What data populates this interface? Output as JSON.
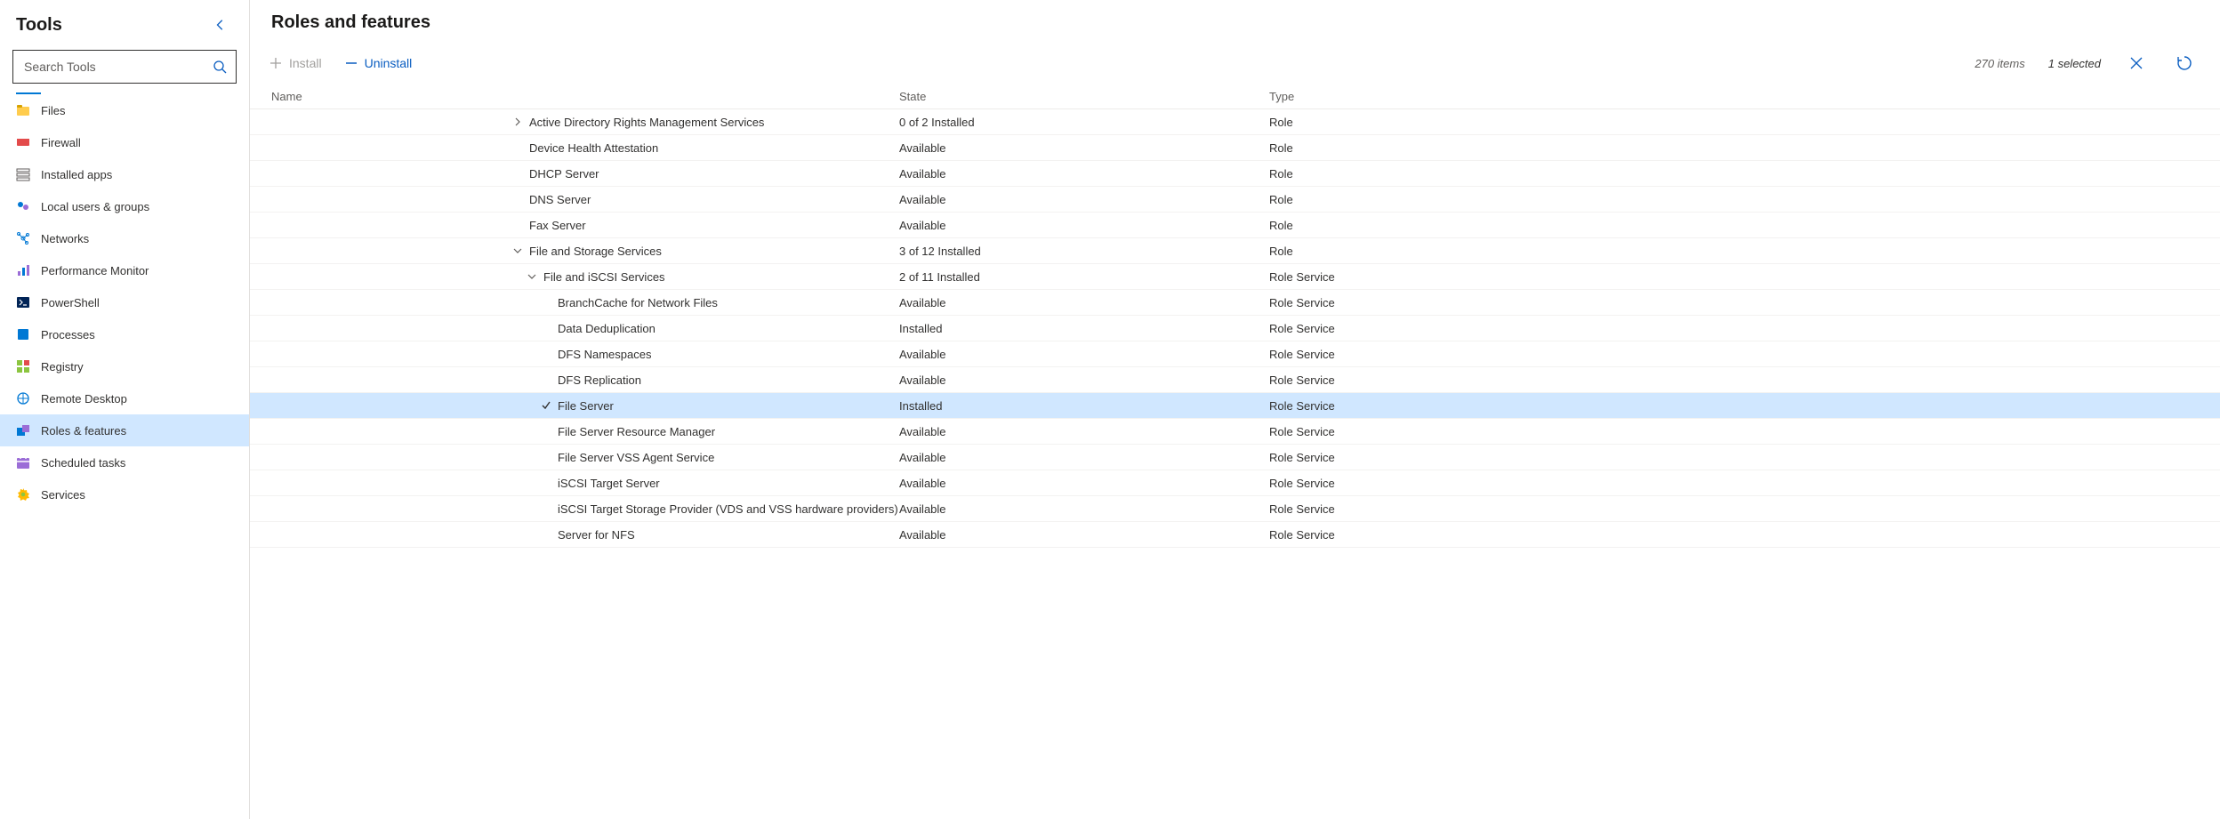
{
  "sidebar": {
    "title": "Tools",
    "search_placeholder": "Search Tools",
    "items": [
      {
        "label": "Files",
        "icon": "files-icon",
        "iconClass": "ic-files"
      },
      {
        "label": "Firewall",
        "icon": "firewall-icon",
        "iconClass": "ic-fire"
      },
      {
        "label": "Installed apps",
        "icon": "apps-icon",
        "iconClass": "ic-apps"
      },
      {
        "label": "Local users & groups",
        "icon": "users-groups-icon",
        "iconClass": "ic-usersg"
      },
      {
        "label": "Networks",
        "icon": "networks-icon",
        "iconClass": "ic-net"
      },
      {
        "label": "Performance Monitor",
        "icon": "perfmon-icon",
        "iconClass": "ic-perf"
      },
      {
        "label": "PowerShell",
        "icon": "powershell-icon",
        "iconClass": "ic-ps"
      },
      {
        "label": "Processes",
        "icon": "processes-icon",
        "iconClass": "ic-proc"
      },
      {
        "label": "Registry",
        "icon": "registry-icon",
        "iconClass": "ic-reg"
      },
      {
        "label": "Remote Desktop",
        "icon": "remote-desktop-icon",
        "iconClass": "ic-rdp"
      },
      {
        "label": "Roles & features",
        "icon": "roles-features-icon",
        "iconClass": "ic-roles",
        "selected": true
      },
      {
        "label": "Scheduled tasks",
        "icon": "scheduled-tasks-icon",
        "iconClass": "ic-sched"
      },
      {
        "label": "Services",
        "icon": "services-icon",
        "iconClass": "ic-svc"
      }
    ]
  },
  "page": {
    "title": "Roles and features",
    "install_label": "Install",
    "uninstall_label": "Uninstall",
    "items_count_label": "270 items",
    "selected_label": "1 selected"
  },
  "grid": {
    "headers": {
      "name": "Name",
      "state": "State",
      "type": "Type"
    },
    "baseIndent": 310,
    "rows": [
      {
        "indent": 0,
        "chevron": "right",
        "checked": false,
        "name": "Active Directory Rights Management Services",
        "state": "0 of 2 Installed",
        "type": "Role"
      },
      {
        "indent": 0,
        "chevron": "none",
        "checked": false,
        "name": "Device Health Attestation",
        "state": "Available",
        "type": "Role"
      },
      {
        "indent": 0,
        "chevron": "none",
        "checked": false,
        "name": "DHCP Server",
        "state": "Available",
        "type": "Role"
      },
      {
        "indent": 0,
        "chevron": "none",
        "checked": false,
        "name": "DNS Server",
        "state": "Available",
        "type": "Role"
      },
      {
        "indent": 0,
        "chevron": "none",
        "checked": false,
        "name": "Fax Server",
        "state": "Available",
        "type": "Role"
      },
      {
        "indent": 0,
        "chevron": "down",
        "checked": false,
        "name": "File and Storage Services",
        "state": "3 of 12 Installed",
        "type": "Role"
      },
      {
        "indent": 1,
        "chevron": "down",
        "checked": false,
        "name": "File and iSCSI Services",
        "state": "2 of 11 Installed",
        "type": "Role Service"
      },
      {
        "indent": 2,
        "chevron": "none",
        "checked": false,
        "name": "BranchCache for Network Files",
        "state": "Available",
        "type": "Role Service"
      },
      {
        "indent": 2,
        "chevron": "none",
        "checked": false,
        "name": "Data Deduplication",
        "state": "Installed",
        "type": "Role Service"
      },
      {
        "indent": 2,
        "chevron": "none",
        "checked": false,
        "name": "DFS Namespaces",
        "state": "Available",
        "type": "Role Service"
      },
      {
        "indent": 2,
        "chevron": "none",
        "checked": false,
        "name": "DFS Replication",
        "state": "Available",
        "type": "Role Service"
      },
      {
        "indent": 2,
        "chevron": "none",
        "checked": true,
        "name": "File Server",
        "state": "Installed",
        "type": "Role Service",
        "selected": true
      },
      {
        "indent": 2,
        "chevron": "none",
        "checked": false,
        "name": "File Server Resource Manager",
        "state": "Available",
        "type": "Role Service"
      },
      {
        "indent": 2,
        "chevron": "none",
        "checked": false,
        "name": "File Server VSS Agent Service",
        "state": "Available",
        "type": "Role Service"
      },
      {
        "indent": 2,
        "chevron": "none",
        "checked": false,
        "name": "iSCSI Target Server",
        "state": "Available",
        "type": "Role Service"
      },
      {
        "indent": 2,
        "chevron": "none",
        "checked": false,
        "name": "iSCSI Target Storage Provider (VDS and VSS hardware providers)",
        "state": "Available",
        "type": "Role Service"
      },
      {
        "indent": 2,
        "chevron": "none",
        "checked": false,
        "name": "Server for NFS",
        "state": "Available",
        "type": "Role Service"
      }
    ]
  }
}
